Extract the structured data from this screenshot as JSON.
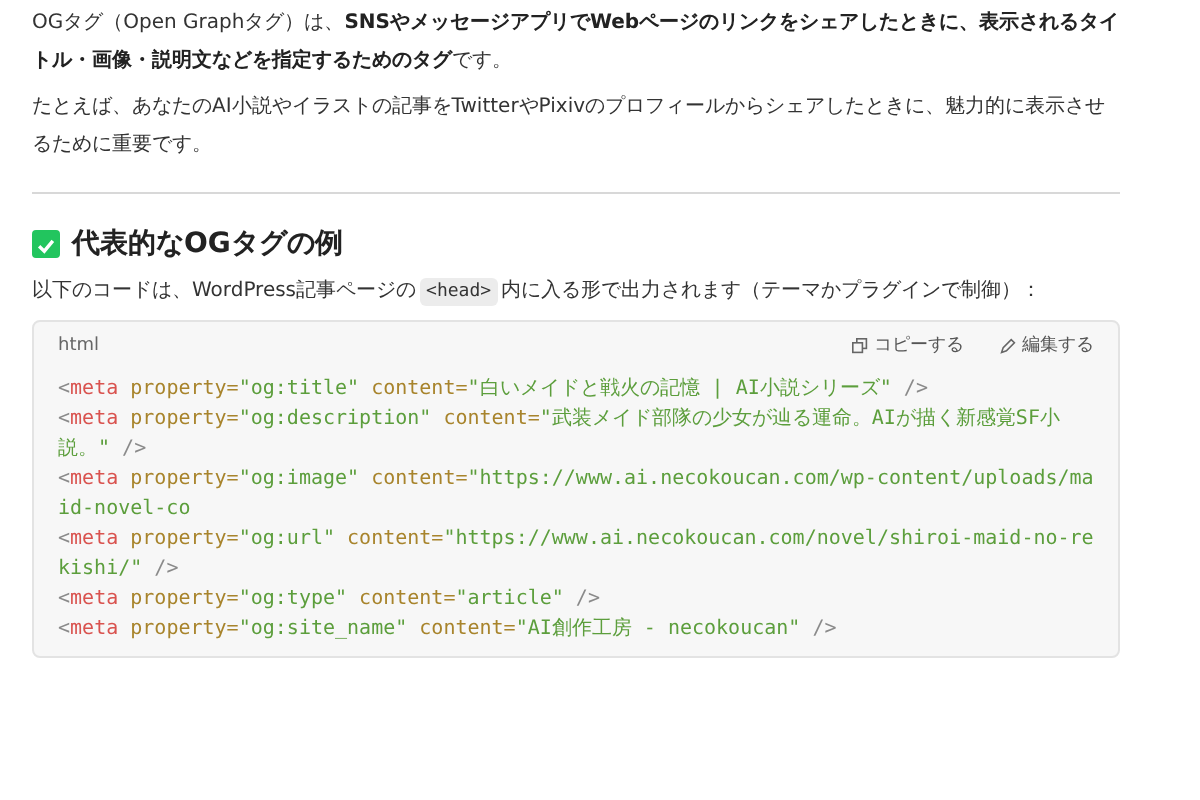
{
  "intro": [
    {
      "text": "OGタグ（Open Graphタグ）は、**SNSやメッセージアプリでWebページのリンクをシェアしたときに、表示されるタイトル・画像・説明文などを指定するためのタグ**です。"
    },
    {
      "text": "たとえば、あなたのAI小説やイラストの記事をTwitterやPixivのプロフィールからシェアしたときに、魅力的に表示させるために重要です。"
    }
  ],
  "section": {
    "heading": "代表的なOGタグの例",
    "checked": true,
    "lead": {
      "before": "以下のコードは、WordPress記事ページの",
      "code": "<head>",
      "after": "内に入る形で出力されます（テーマかプラグインで制御）："
    },
    "code_block": {
      "language": "html",
      "copy_label": "コピーする",
      "edit_label": "編集する",
      "lines": [
        [
          {
            "kind": "punct",
            "text": "<"
          },
          {
            "kind": "tag",
            "text": "meta"
          },
          {
            "kind": "attr",
            "text": " property="
          },
          {
            "kind": "value",
            "text": "\"og:title\""
          },
          {
            "kind": "attr",
            "text": " content="
          },
          {
            "kind": "value",
            "text": "\"白いメイドと戦火の記憶 | AI小説シリーズ\""
          },
          {
            "kind": "punct",
            "text": " />"
          }
        ],
        [
          {
            "kind": "punct",
            "text": "<"
          },
          {
            "kind": "tag",
            "text": "meta"
          },
          {
            "kind": "attr",
            "text": " property="
          },
          {
            "kind": "value",
            "text": "\"og:description\""
          },
          {
            "kind": "attr",
            "text": " content="
          },
          {
            "kind": "value",
            "text": "\"武装メイド部隊の少女が辿る運命。AIが描く新感覚SF小説。\""
          },
          {
            "kind": "punct",
            "text": " />"
          }
        ],
        [
          {
            "kind": "punct",
            "text": "<"
          },
          {
            "kind": "tag",
            "text": "meta"
          },
          {
            "kind": "attr",
            "text": " property="
          },
          {
            "kind": "value",
            "text": "\"og:image\""
          },
          {
            "kind": "attr",
            "text": " content="
          },
          {
            "kind": "value",
            "text": "\"https://www.ai.necokoucan.com/wp-content/uploads/maid-novel-co"
          }
        ],
        [
          {
            "kind": "punct",
            "text": "<"
          },
          {
            "kind": "tag",
            "text": "meta"
          },
          {
            "kind": "attr",
            "text": " property="
          },
          {
            "kind": "value",
            "text": "\"og:url\""
          },
          {
            "kind": "attr",
            "text": " content="
          },
          {
            "kind": "value",
            "text": "\"https://www.ai.necokoucan.com/novel/shiroi-maid-no-rekishi/\""
          },
          {
            "kind": "punct",
            "text": " />"
          }
        ],
        [
          {
            "kind": "punct",
            "text": "<"
          },
          {
            "kind": "tag",
            "text": "meta"
          },
          {
            "kind": "attr",
            "text": " property="
          },
          {
            "kind": "value",
            "text": "\"og:type\""
          },
          {
            "kind": "attr",
            "text": " content="
          },
          {
            "kind": "value",
            "text": "\"article\""
          },
          {
            "kind": "punct",
            "text": " />"
          }
        ],
        [
          {
            "kind": "punct",
            "text": "<"
          },
          {
            "kind": "tag",
            "text": "meta"
          },
          {
            "kind": "attr",
            "text": " property="
          },
          {
            "kind": "value",
            "text": "\"og:site_name\""
          },
          {
            "kind": "attr",
            "text": " content="
          },
          {
            "kind": "value",
            "text": "\"AI創作工房 - necokoucan\""
          },
          {
            "kind": "punct",
            "text": " />"
          }
        ]
      ]
    }
  }
}
